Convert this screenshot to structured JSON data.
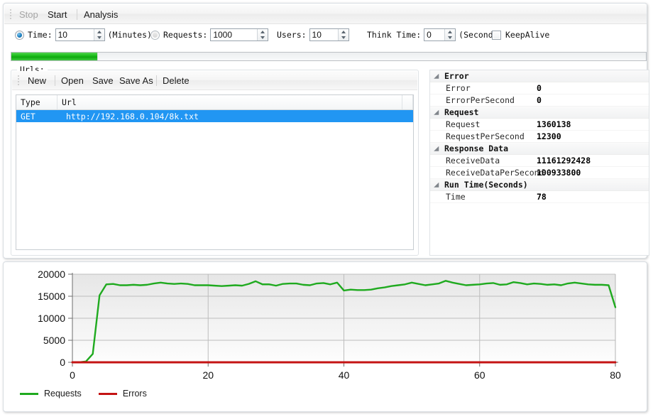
{
  "toolbar": {
    "buttons": [
      {
        "label": "Stop",
        "enabled": false
      },
      {
        "label": "Start",
        "enabled": true
      },
      {
        "label": "Analysis",
        "enabled": true
      }
    ]
  },
  "params": {
    "time": {
      "label": "Time:",
      "value": "10",
      "suffix": "(Minutes)",
      "selected": true
    },
    "requests": {
      "label": "Requests:",
      "value": "1000",
      "selected": false
    },
    "users": {
      "label": "Users:",
      "value": "10"
    },
    "think_time": {
      "label": "Think Time:",
      "value": "0",
      "suffix": "(Seconds)"
    },
    "keepalive": {
      "label": "KeepAlive",
      "checked": false
    }
  },
  "progress": {
    "percent": 13.5
  },
  "urls": {
    "group_title": "Urls:",
    "buttons": [
      "New",
      "Open",
      "Save",
      "Save As",
      "Delete"
    ],
    "columns": [
      "Type",
      "Url"
    ],
    "rows": [
      {
        "type": "GET",
        "url": "http://192.168.0.104/8k.txt",
        "selected": true
      }
    ]
  },
  "stats": {
    "groups": [
      {
        "name": "Error",
        "items": [
          {
            "name": "Error",
            "value": "0"
          },
          {
            "name": "ErrorPerSecond",
            "value": "0"
          }
        ]
      },
      {
        "name": "Request",
        "items": [
          {
            "name": "Request",
            "value": "1360138"
          },
          {
            "name": "RequestPerSecond",
            "value": "12300"
          }
        ]
      },
      {
        "name": "Response Data",
        "items": [
          {
            "name": "ReceiveData",
            "value": "11161292428"
          },
          {
            "name": "ReceiveDataPerSecond",
            "value": "100933800"
          }
        ]
      },
      {
        "name": "Run Time(Seconds)",
        "items": [
          {
            "name": "Time",
            "value": "78"
          }
        ]
      }
    ]
  },
  "legend": [
    {
      "label": "Requests",
      "color": "#1faa1f"
    },
    {
      "label": "Errors",
      "color": "#c41313"
    }
  ],
  "chart_data": {
    "type": "line",
    "title": "",
    "xlabel": "",
    "ylabel": "",
    "xlim": [
      0,
      80
    ],
    "ylim": [
      0,
      20000
    ],
    "xticks": [
      0,
      20,
      40,
      60,
      80
    ],
    "yticks": [
      0,
      5000,
      10000,
      15000,
      20000
    ],
    "grid": true,
    "legend_position": "bottom-left",
    "series": [
      {
        "name": "Requests",
        "color": "#1faa1f",
        "x": [
          0,
          1,
          2,
          3,
          4,
          5,
          6,
          7,
          8,
          9,
          10,
          11,
          12,
          13,
          14,
          15,
          16,
          17,
          18,
          19,
          20,
          21,
          22,
          23,
          24,
          25,
          26,
          27,
          28,
          29,
          30,
          31,
          32,
          33,
          34,
          35,
          36,
          37,
          38,
          39,
          40,
          41,
          42,
          43,
          44,
          45,
          46,
          47,
          48,
          49,
          50,
          51,
          52,
          53,
          54,
          55,
          56,
          57,
          58,
          59,
          60,
          61,
          62,
          63,
          64,
          65,
          66,
          67,
          68,
          69,
          70,
          71,
          72,
          73,
          74,
          75,
          76,
          77,
          78,
          79,
          80
        ],
        "y": [
          0,
          0,
          200,
          1900,
          15200,
          17700,
          17800,
          17500,
          17500,
          17600,
          17500,
          17600,
          17900,
          18100,
          17900,
          17800,
          17900,
          17800,
          17500,
          17500,
          17500,
          17400,
          17300,
          17400,
          17500,
          17400,
          17800,
          18400,
          17700,
          17700,
          17400,
          17800,
          17900,
          17900,
          17600,
          17500,
          17900,
          18000,
          17700,
          18100,
          16300,
          16500,
          16400,
          16400,
          16500,
          16800,
          17000,
          17300,
          17500,
          17700,
          18100,
          17800,
          17500,
          17700,
          17900,
          18500,
          18100,
          17800,
          17500,
          17600,
          17700,
          17900,
          18000,
          17600,
          17700,
          18200,
          18000,
          17700,
          17900,
          17800,
          17600,
          17700,
          17500,
          17900,
          18100,
          17900,
          17700,
          17600,
          17600,
          17500,
          12500
        ]
      },
      {
        "name": "Errors",
        "color": "#c41313",
        "x": [
          0,
          10,
          20,
          30,
          40,
          50,
          60,
          70,
          80
        ],
        "y": [
          0,
          0,
          0,
          0,
          0,
          0,
          0,
          0,
          0
        ]
      }
    ]
  }
}
